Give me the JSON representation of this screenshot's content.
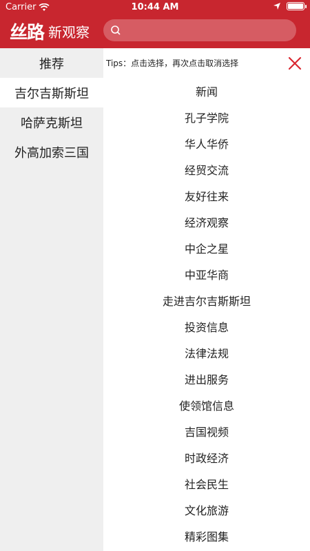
{
  "status_bar": {
    "carrier": "Carrier",
    "time": "10:44 AM"
  },
  "header": {
    "logo_mark": "丝路",
    "logo_text": "新观察",
    "search_placeholder": ""
  },
  "sidebar": {
    "items": [
      {
        "label": "推荐"
      },
      {
        "label": "吉尔吉斯斯坦"
      },
      {
        "label": "哈萨克斯坦"
      },
      {
        "label": "外高加索三国"
      }
    ]
  },
  "content": {
    "tips": "Tips：点击选择，再次点击取消选择",
    "items": [
      {
        "label": "新闻"
      },
      {
        "label": "孔子学院"
      },
      {
        "label": "华人华侨"
      },
      {
        "label": "经贸交流"
      },
      {
        "label": "友好往来"
      },
      {
        "label": "经济观察"
      },
      {
        "label": "中企之星"
      },
      {
        "label": "中亚华商"
      },
      {
        "label": "走进吉尔吉斯斯坦"
      },
      {
        "label": "投资信息"
      },
      {
        "label": "法律法规"
      },
      {
        "label": "进出服务"
      },
      {
        "label": "使领馆信息"
      },
      {
        "label": "吉国视频"
      },
      {
        "label": "时政经济"
      },
      {
        "label": "社会民生"
      },
      {
        "label": "文化旅游"
      },
      {
        "label": "精彩图集"
      }
    ]
  },
  "colors": {
    "brand_red": "#c8262f",
    "sidebar_bg": "#efefef",
    "close_red": "#d9262f"
  }
}
